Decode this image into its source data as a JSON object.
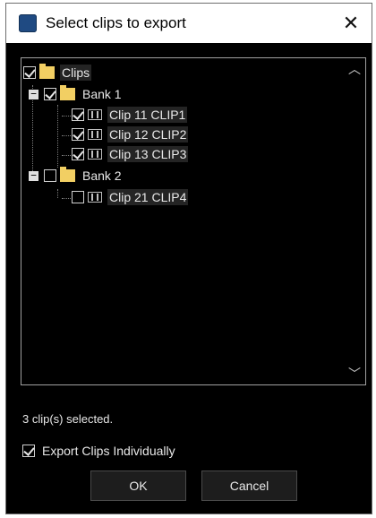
{
  "window": {
    "title": "Select clips to export",
    "close_glyph": "✕"
  },
  "tree": {
    "root": {
      "label": "Clips",
      "checked": true,
      "icon": "folder-icon"
    },
    "banks": [
      {
        "label": "Bank 1",
        "checked": true,
        "expanded": true,
        "expander": "−",
        "clips": [
          {
            "label": "Clip 11 CLIP1",
            "checked": true
          },
          {
            "label": "Clip 12 CLIP2",
            "checked": true
          },
          {
            "label": "Clip 13 CLIP3",
            "checked": true
          }
        ]
      },
      {
        "label": "Bank 2",
        "checked": false,
        "expanded": true,
        "expander": "−",
        "clips": [
          {
            "label": "Clip 21 CLIP4",
            "checked": false
          }
        ]
      }
    ],
    "scroll_up_glyph": "︿",
    "scroll_down_glyph": "﹀"
  },
  "status": {
    "text": "3 clip(s) selected."
  },
  "options": {
    "export_individually_label": "Export Clips Individually",
    "export_individually_checked": true
  },
  "buttons": {
    "ok": "OK",
    "cancel": "Cancel"
  },
  "colors": {
    "background": "#000000",
    "folder": "#f2cf63",
    "app_icon": "#1f4a82"
  }
}
